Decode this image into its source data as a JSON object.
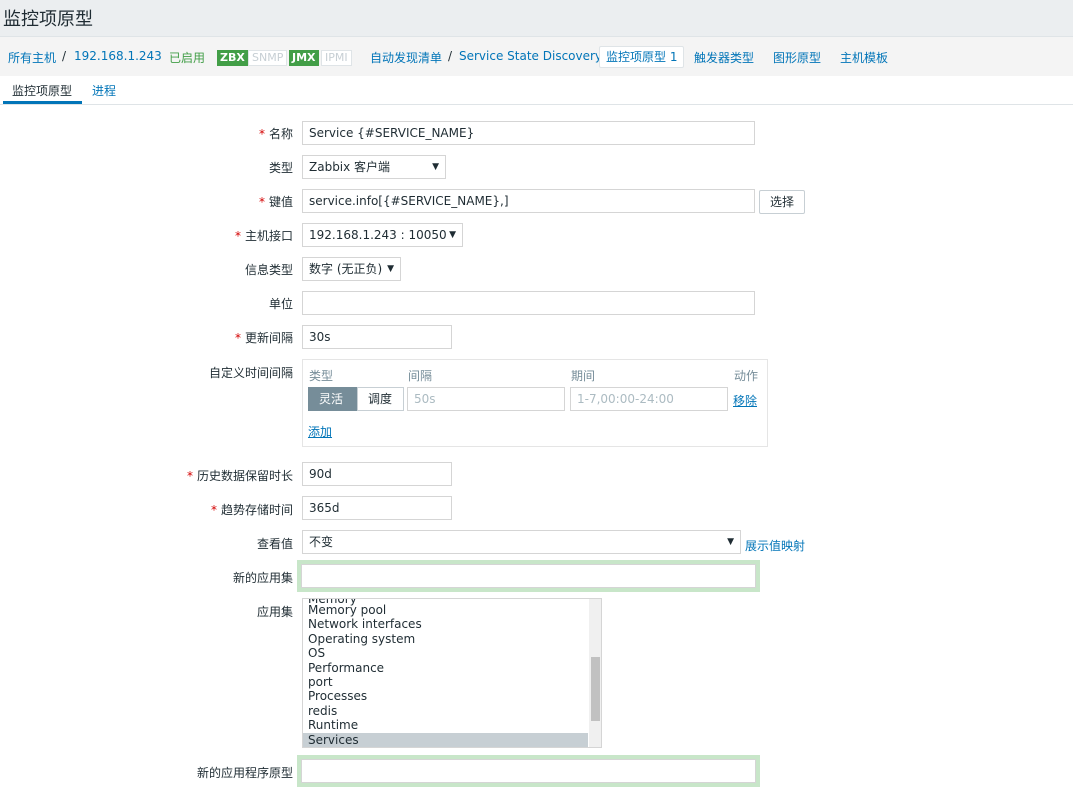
{
  "page": {
    "title": "监控项原型"
  },
  "breadcrumbs": {
    "all_hosts": "所有主机",
    "host": "192.168.1.243",
    "enabled": "已启用",
    "zbx": "ZBX",
    "snmp": "SNMP",
    "jmx": "JMX",
    "ipmi": "IPMI",
    "discovery_list": "自动发现清单",
    "discovery_rule": "Service State Discovery",
    "item_prototypes": "监控项原型 1",
    "trigger_prototypes": "触发器类型",
    "graph_prototypes": "图形原型",
    "host_prototypes": "主机模板",
    "sep": "/"
  },
  "tabs": {
    "item_prototype": "监控项原型",
    "process": "进程"
  },
  "form": {
    "name_label": "名称",
    "name_value": "Service {#SERVICE_NAME}",
    "type_label": "类型",
    "type_value": "Zabbix 客户端",
    "key_label": "键值",
    "key_value": "service.info[{#SERVICE_NAME},]",
    "select_button": "选择",
    "interface_label": "主机接口",
    "interface_value": "192.168.1.243 : 10050",
    "info_type_label": "信息类型",
    "info_type_value": "数字 (无正负)",
    "units_label": "单位",
    "units_value": "",
    "update_label": "更新间隔",
    "update_value": "30s",
    "custom_label": "自定义时间间隔",
    "custom": {
      "col_type": "类型",
      "col_interval": "间隔",
      "col_period": "期间",
      "col_action": "动作",
      "flexible": "灵活",
      "scheduling": "调度",
      "interval_placeholder": "50s",
      "period_placeholder": "1-7,00:00-24:00",
      "remove": "移除",
      "add": "添加"
    },
    "history_label": "历史数据保留时长",
    "history_value": "90d",
    "trends_label": "趋势存储时间",
    "trends_value": "365d",
    "valuemap_label": "查看值",
    "valuemap_value": "不变",
    "valuemap_link": "展示值映射",
    "new_app_label": "新的应用集",
    "app_label": "应用集",
    "applications": [
      "Memory pool",
      "Network interfaces",
      "Operating system",
      "OS",
      "Performance",
      "port",
      "Processes",
      "redis",
      "Runtime",
      "Services"
    ],
    "new_app_proto_label": "新的应用程序原型"
  }
}
